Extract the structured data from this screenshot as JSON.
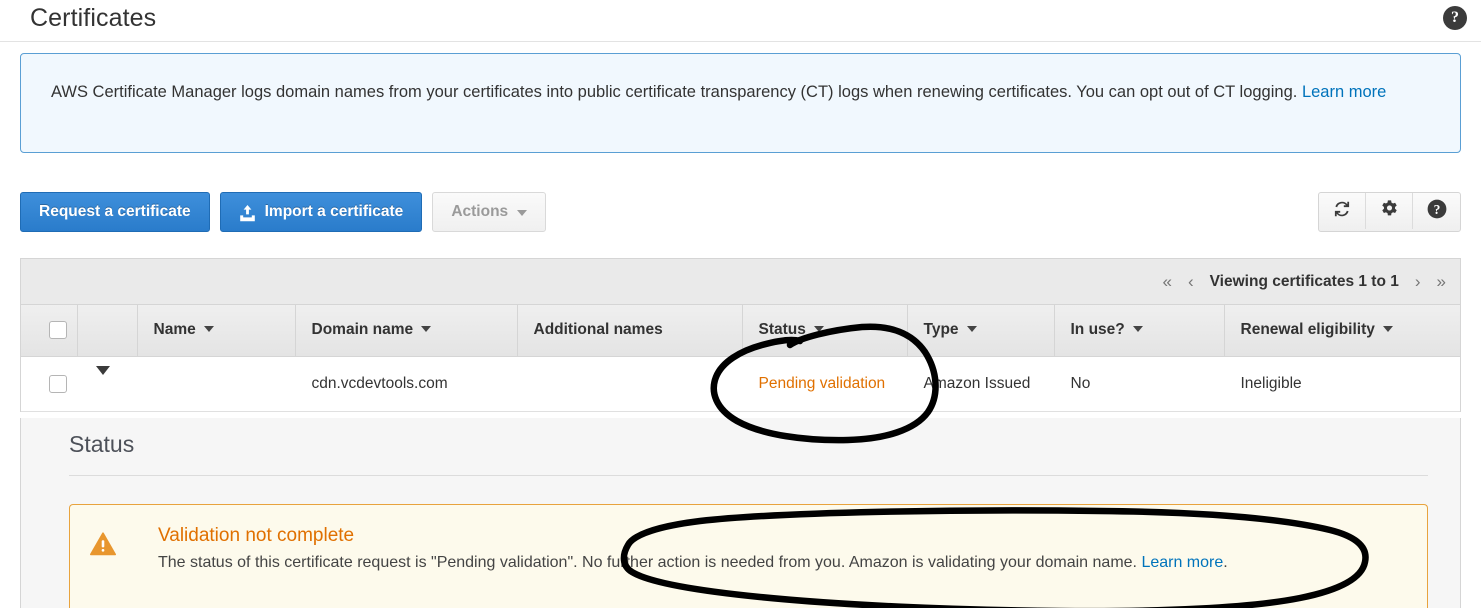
{
  "header": {
    "title": "Certificates",
    "help_icon": "question-circle-icon",
    "help_label": "?"
  },
  "info_banner": {
    "text_before_link": "AWS Certificate Manager logs domain names from your certificates into public certificate transparency (CT) logs when renewing certificates. You can opt out of CT logging. ",
    "link_label": "Learn more",
    "border_color": "#5a9fd4",
    "background_color": "#f1f8fe"
  },
  "toolbar": {
    "request_label": "Request a certificate",
    "import_label": "Import a certificate",
    "import_icon": "upload-icon",
    "actions_label": "Actions",
    "actions_enabled": false,
    "refresh_icon": "refresh-icon",
    "settings_icon": "gear-icon",
    "help_icon": "question-circle-icon",
    "primary_color": "#2a7ccb"
  },
  "table": {
    "pager": {
      "first_label": "«",
      "prev_label": "‹",
      "viewing_label": "Viewing certificates 1 to 1",
      "next_label": "›",
      "last_label": "»"
    },
    "columns": [
      {
        "key": "select",
        "label": "",
        "sortable": false
      },
      {
        "key": "expand",
        "label": "",
        "sortable": false
      },
      {
        "key": "name",
        "label": "Name",
        "sortable": true
      },
      {
        "key": "domain",
        "label": "Domain name",
        "sortable": true
      },
      {
        "key": "addl",
        "label": "Additional names",
        "sortable": false
      },
      {
        "key": "status",
        "label": "Status",
        "sortable": true
      },
      {
        "key": "type",
        "label": "Type",
        "sortable": true
      },
      {
        "key": "inuse",
        "label": "In use?",
        "sortable": true
      },
      {
        "key": "renewal",
        "label": "Renewal eligibility",
        "sortable": true
      }
    ],
    "rows": [
      {
        "name": "",
        "domain": "cdn.vcdevtools.com",
        "additional_names": "",
        "status": "Pending validation",
        "status_color": "#e07000",
        "type": "Amazon Issued",
        "in_use": "No",
        "renewal_eligibility": "Ineligible"
      }
    ]
  },
  "detail": {
    "heading": "Status",
    "alert": {
      "icon": "warning-triangle-icon",
      "title": "Validation not complete",
      "text_before_link": "The status of this certificate request is \"Pending validation\". No further action is needed from you. Amazon is validating your domain name. ",
      "link_label": "Learn more",
      "text_after_link": ".",
      "accent_color": "#e07000",
      "background_color": "#fdfaec"
    }
  },
  "annotations": {
    "color": "#000000",
    "items": [
      {
        "name": "circle-around-pending-validation",
        "target": "status cell"
      },
      {
        "name": "circle-around-alert-message",
        "target": "alert body text"
      }
    ]
  }
}
